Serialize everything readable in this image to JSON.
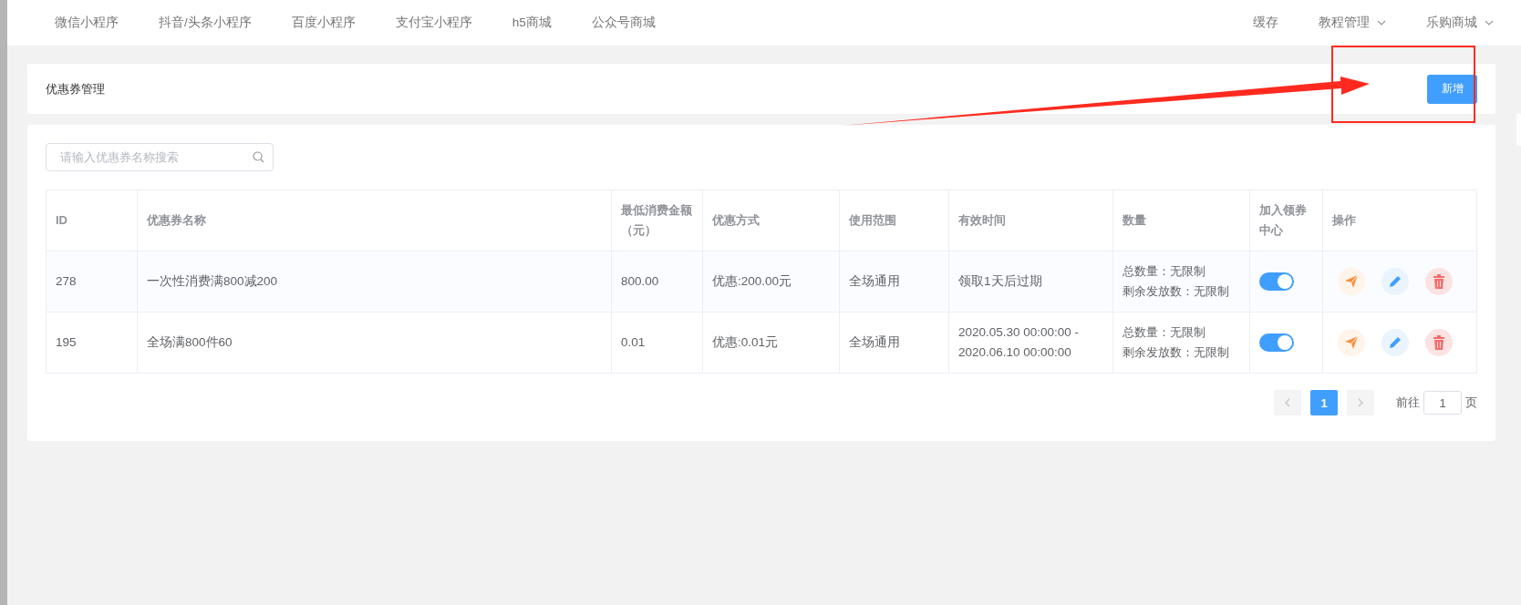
{
  "top_nav": {
    "left_items": [
      "微信小程序",
      "抖音/头条小程序",
      "百度小程序",
      "支付宝小程序",
      "h5商城",
      "公众号商城"
    ],
    "right_items": [
      {
        "label": "缓存",
        "dropdown": false
      },
      {
        "label": "教程管理",
        "dropdown": true
      },
      {
        "label": "乐购商城",
        "dropdown": true
      }
    ]
  },
  "header": {
    "title": "优惠券管理",
    "add_button": "新增"
  },
  "search": {
    "placeholder": "请输入优惠券名称搜索"
  },
  "table": {
    "columns": [
      "ID",
      "优惠券名称",
      "最低消费金额（元）",
      "优惠方式",
      "使用范围",
      "有效时间",
      "数量",
      "加入领券中心",
      "操作"
    ],
    "rows": [
      {
        "id": "278",
        "name": "一次性消费满800减200",
        "min_amount": "800.00",
        "discount": "优惠:200.00元",
        "scope": "全场通用",
        "valid_time": "领取1天后过期",
        "quantity": [
          "总数量：无限制",
          "剩余发放数：无限制"
        ],
        "in_center": true
      },
      {
        "id": "195",
        "name": "全场满800件60",
        "min_amount": "0.01",
        "discount": "优惠:0.01元",
        "scope": "全场通用",
        "valid_time": "2020.05.30 00:00:00 - 2020.06.10 00:00:00",
        "quantity": [
          "总数量：无限制",
          "剩余发放数：无限制"
        ],
        "in_center": true
      }
    ]
  },
  "pagination": {
    "pages": [
      {
        "label": "1",
        "selected": true
      }
    ],
    "goto_label": "前往",
    "goto_value": "1",
    "page_suffix": "页"
  }
}
